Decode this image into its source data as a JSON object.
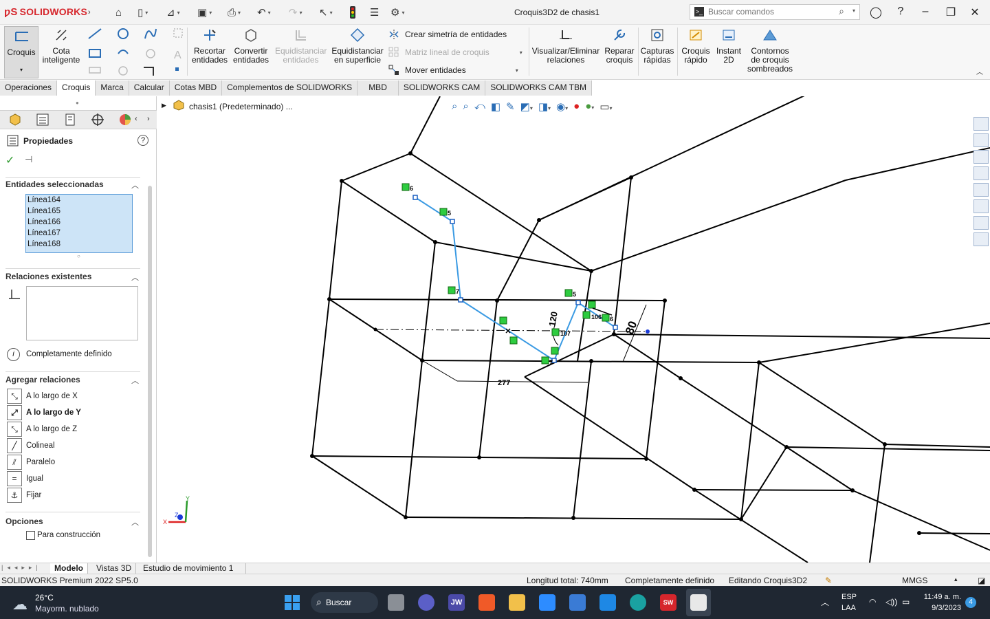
{
  "titlebar": {
    "brand": "SOLIDWORKS",
    "window_title": "Croquis3D2 de chasis1",
    "search_placeholder": "Buscar comandos"
  },
  "ribbon": {
    "croquis": "Croquis",
    "cota": "Cota inteligente",
    "recortar": "Recortar entidades",
    "convertir": "Convertir entidades",
    "equidistanciar": "Equidistanciar entidades",
    "equid_superficie": "Equidistanciar en superficie",
    "crear_simetria": "Crear simetría de entidades",
    "matriz_lineal": "Matriz lineal de croquis",
    "mover": "Mover entidades",
    "visualizar": "Visualizar/Eliminar relaciones",
    "reparar": "Reparar croquis",
    "capturas": "Capturas rápidas",
    "croquis_rapido": "Croquis rápido",
    "instant2d": "Instant 2D",
    "contornos": "Contornos de croquis sombreados"
  },
  "tabs": [
    "Operaciones",
    "Croquis",
    "Marca",
    "Calcular",
    "Cotas MBD",
    "Complementos de SOLIDWORKS",
    "MBD",
    "SOLIDWORKS CAM",
    "SOLIDWORKS CAM TBM"
  ],
  "active_tab": "Croquis",
  "tree": {
    "part": "chasis1 (Predeterminado) ..."
  },
  "panel": {
    "title": "Propiedades",
    "sel_header": "Entidades seleccionadas",
    "selected": [
      "Línea164",
      "Línea165",
      "Línea166",
      "Línea167",
      "Línea168"
    ],
    "rel_header": "Relaciones existentes",
    "status": "Completamente definido",
    "add_header": "Agregar relaciones",
    "relations": [
      "A lo largo de X",
      "A lo largo de Y",
      "A lo largo de Z",
      "Colineal",
      "Paralelo",
      "Igual",
      "Fijar"
    ],
    "options_header": "Opciones",
    "construction": "Para construcción"
  },
  "bottom_tabs": [
    "Modelo",
    "Vistas 3D",
    "Estudio de movimiento 1"
  ],
  "status": {
    "version": "SOLIDWORKS Premium 2022 SP5.0",
    "length": "Longitud total: 740mm",
    "defined": "Completamente definido",
    "editing": "Editando Croquis3D2",
    "units": "MMGS"
  },
  "taskbar": {
    "temp": "26°C",
    "weather": "Mayorm. nublado",
    "search": "Buscar",
    "lang1": "ESP",
    "lang2": "LAA",
    "time": "11:49 a. m.",
    "date": "9/3/2023",
    "badge": "4"
  },
  "canvas_labels": {
    "relation_tags": [
      "6",
      "5",
      "7",
      "5",
      "6",
      "106",
      "107",
      "7"
    ],
    "dimensions": [
      "120",
      "80",
      "277"
    ]
  }
}
